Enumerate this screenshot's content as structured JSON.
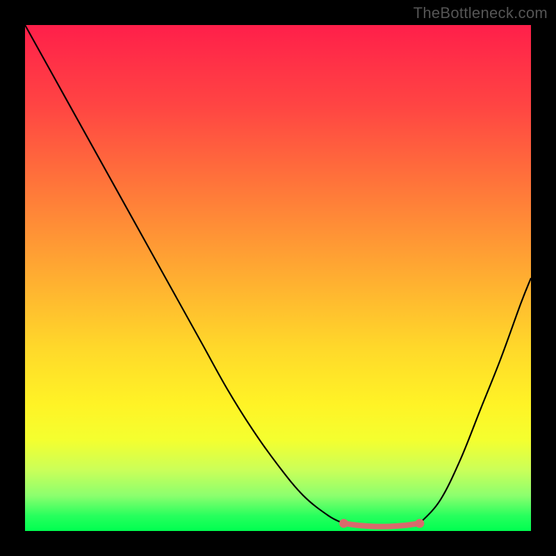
{
  "watermark": "TheBottleneck.com",
  "colors": {
    "bg": "#000000",
    "curve": "#000000",
    "sweet_spot": "#d96a6c"
  },
  "chart_data": {
    "type": "line",
    "title": "",
    "xlabel": "",
    "ylabel": "",
    "xlim": [
      0,
      100
    ],
    "ylim": [
      0,
      100
    ],
    "series": [
      {
        "name": "bottleneck-curve-left",
        "x": [
          0,
          5,
          10,
          15,
          20,
          25,
          30,
          35,
          40,
          45,
          50,
          55,
          60,
          63
        ],
        "values": [
          100,
          91,
          82,
          73,
          64,
          55,
          46,
          37,
          28,
          20,
          13,
          7,
          3,
          1.5
        ]
      },
      {
        "name": "bottleneck-curve-right",
        "x": [
          78,
          82,
          86,
          90,
          94,
          98,
          100
        ],
        "values": [
          1.5,
          6,
          14,
          24,
          34,
          45,
          50
        ]
      },
      {
        "name": "sweet-spot",
        "x": [
          63,
          66,
          69,
          72,
          75,
          78
        ],
        "values": [
          1.5,
          1.1,
          0.9,
          0.9,
          1.1,
          1.5
        ]
      }
    ],
    "markers": [
      {
        "name": "sweet-start",
        "x": 63,
        "y": 1.5
      },
      {
        "name": "sweet-end",
        "x": 78,
        "y": 1.5
      }
    ]
  }
}
